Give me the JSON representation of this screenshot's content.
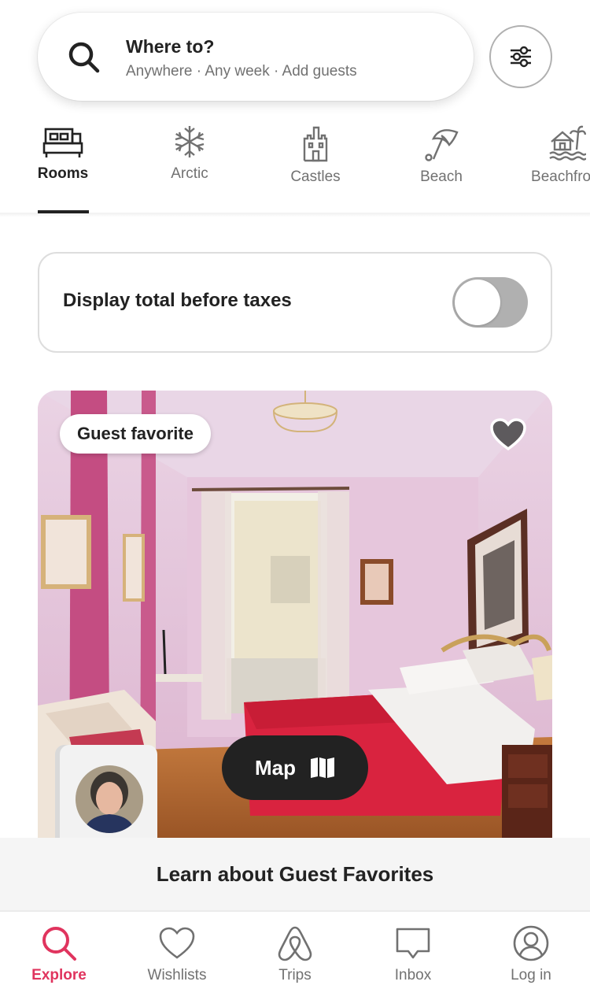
{
  "search": {
    "title": "Where to?",
    "subtitle": "Anywhere · Any week · Add guests",
    "icon": "search-icon"
  },
  "filters": {
    "icon": "sliders-icon"
  },
  "categories": [
    {
      "label": "Rooms",
      "icon": "bed-icon",
      "active": true
    },
    {
      "label": "Arctic",
      "icon": "snowflake-icon",
      "active": false
    },
    {
      "label": "Castles",
      "icon": "castle-icon",
      "active": false
    },
    {
      "label": "Beach",
      "icon": "umbrella-icon",
      "active": false
    },
    {
      "label": "Beachfront",
      "icon": "beach-house-icon",
      "active": false
    }
  ],
  "tax_toggle": {
    "label": "Display total before taxes",
    "on": false
  },
  "listing": {
    "badge": "Guest favorite",
    "favorite_icon": "heart-icon"
  },
  "map_button": {
    "label": "Map",
    "icon": "map-icon"
  },
  "learn_banner": "Learn about Guest Favorites",
  "bottom_nav": [
    {
      "label": "Explore",
      "icon": "search-icon",
      "active": true
    },
    {
      "label": "Wishlists",
      "icon": "heart-outline-icon",
      "active": false
    },
    {
      "label": "Trips",
      "icon": "airbnb-logo-icon",
      "active": false
    },
    {
      "label": "Inbox",
      "icon": "message-icon",
      "active": false
    },
    {
      "label": "Log in",
      "icon": "user-circle-icon",
      "active": false
    }
  ],
  "colors": {
    "accent": "#e0345e",
    "text": "#222222",
    "muted": "#717171",
    "toggle_off": "#b0b0b0"
  }
}
